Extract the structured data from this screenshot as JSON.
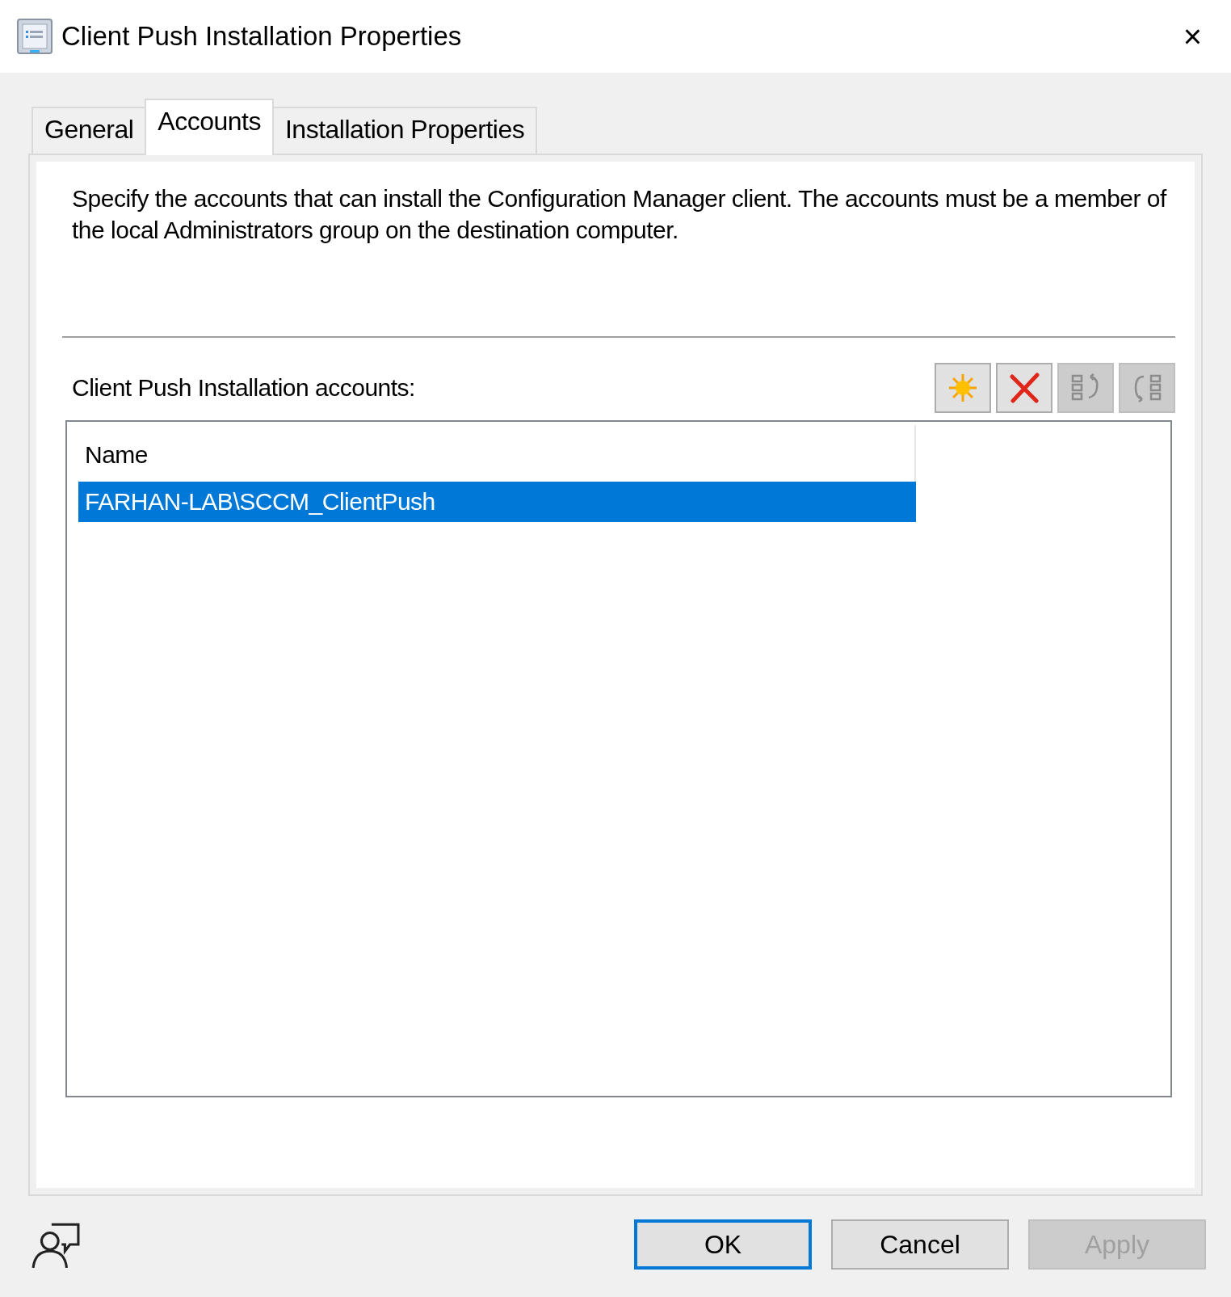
{
  "window": {
    "title": "Client Push Installation Properties",
    "close": "×"
  },
  "tabs": [
    {
      "label": "General",
      "selected": false
    },
    {
      "label": "Accounts",
      "selected": true
    },
    {
      "label": "Installation Properties",
      "selected": false
    }
  ],
  "description": "Specify the accounts that can install the Configuration Manager client. The accounts must be a member of the local Administrators group on the destination computer.",
  "accounts_label": "Client Push Installation accounts:",
  "toolbar": [
    {
      "kind": "new",
      "disabled": false
    },
    {
      "kind": "delete",
      "disabled": false
    },
    {
      "kind": "move-up",
      "disabled": true
    },
    {
      "kind": "move-down",
      "disabled": true
    }
  ],
  "list": {
    "columns": [
      "Name"
    ],
    "rows": [
      {
        "name": "FARHAN-LAB\\SCCM_ClientPush",
        "selected": true
      }
    ]
  },
  "buttons": [
    {
      "label": "OK",
      "default": true,
      "disabled": false
    },
    {
      "label": "Cancel",
      "default": false,
      "disabled": false
    },
    {
      "label": "Apply",
      "default": false,
      "disabled": true
    }
  ]
}
